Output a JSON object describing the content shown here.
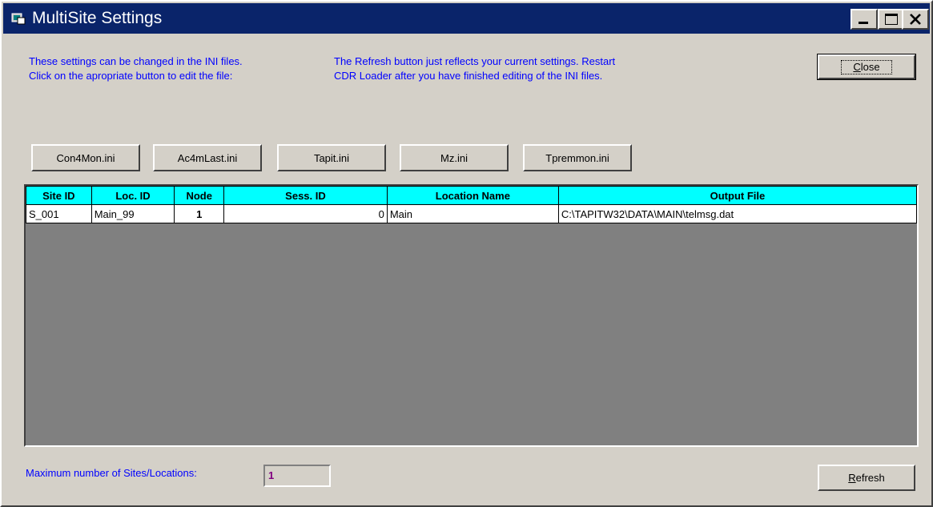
{
  "window": {
    "title": "MultiSite Settings"
  },
  "info": {
    "left_line1": "These settings can be changed in the INI files.",
    "left_line2": "Click on the apropriate button to edit the file:",
    "right_line1": "The Refresh button just reflects your current settings. Restart",
    "right_line2": "CDR Loader after you have finished editing of the INI files."
  },
  "buttons": {
    "close_first": "C",
    "close_rest": "lose",
    "refresh_first": "R",
    "refresh_rest": "efresh"
  },
  "ini_buttons": [
    "Con4Mon.ini",
    "Ac4mLast.ini",
    "Tapit.ini",
    "Mz.ini",
    "Tpremmon.ini"
  ],
  "grid": {
    "columns": [
      "Site ID",
      "Loc. ID",
      "Node",
      "Sess. ID",
      "Location Name",
      "Output File"
    ],
    "rows": [
      [
        "S_001",
        "Main_99",
        "1",
        "0",
        "Main",
        "C:\\TAPITW32\\DATA\\MAIN\\telmsg.dat"
      ]
    ]
  },
  "footer": {
    "max_label": "Maximum number of Sites/Locations:",
    "max_value": "1"
  },
  "colors": {
    "titlebar": "#0a246a",
    "info_text": "#0000ff",
    "grid_header": "#00ffff",
    "grid_background": "#808080",
    "max_value_text": "#800080"
  }
}
